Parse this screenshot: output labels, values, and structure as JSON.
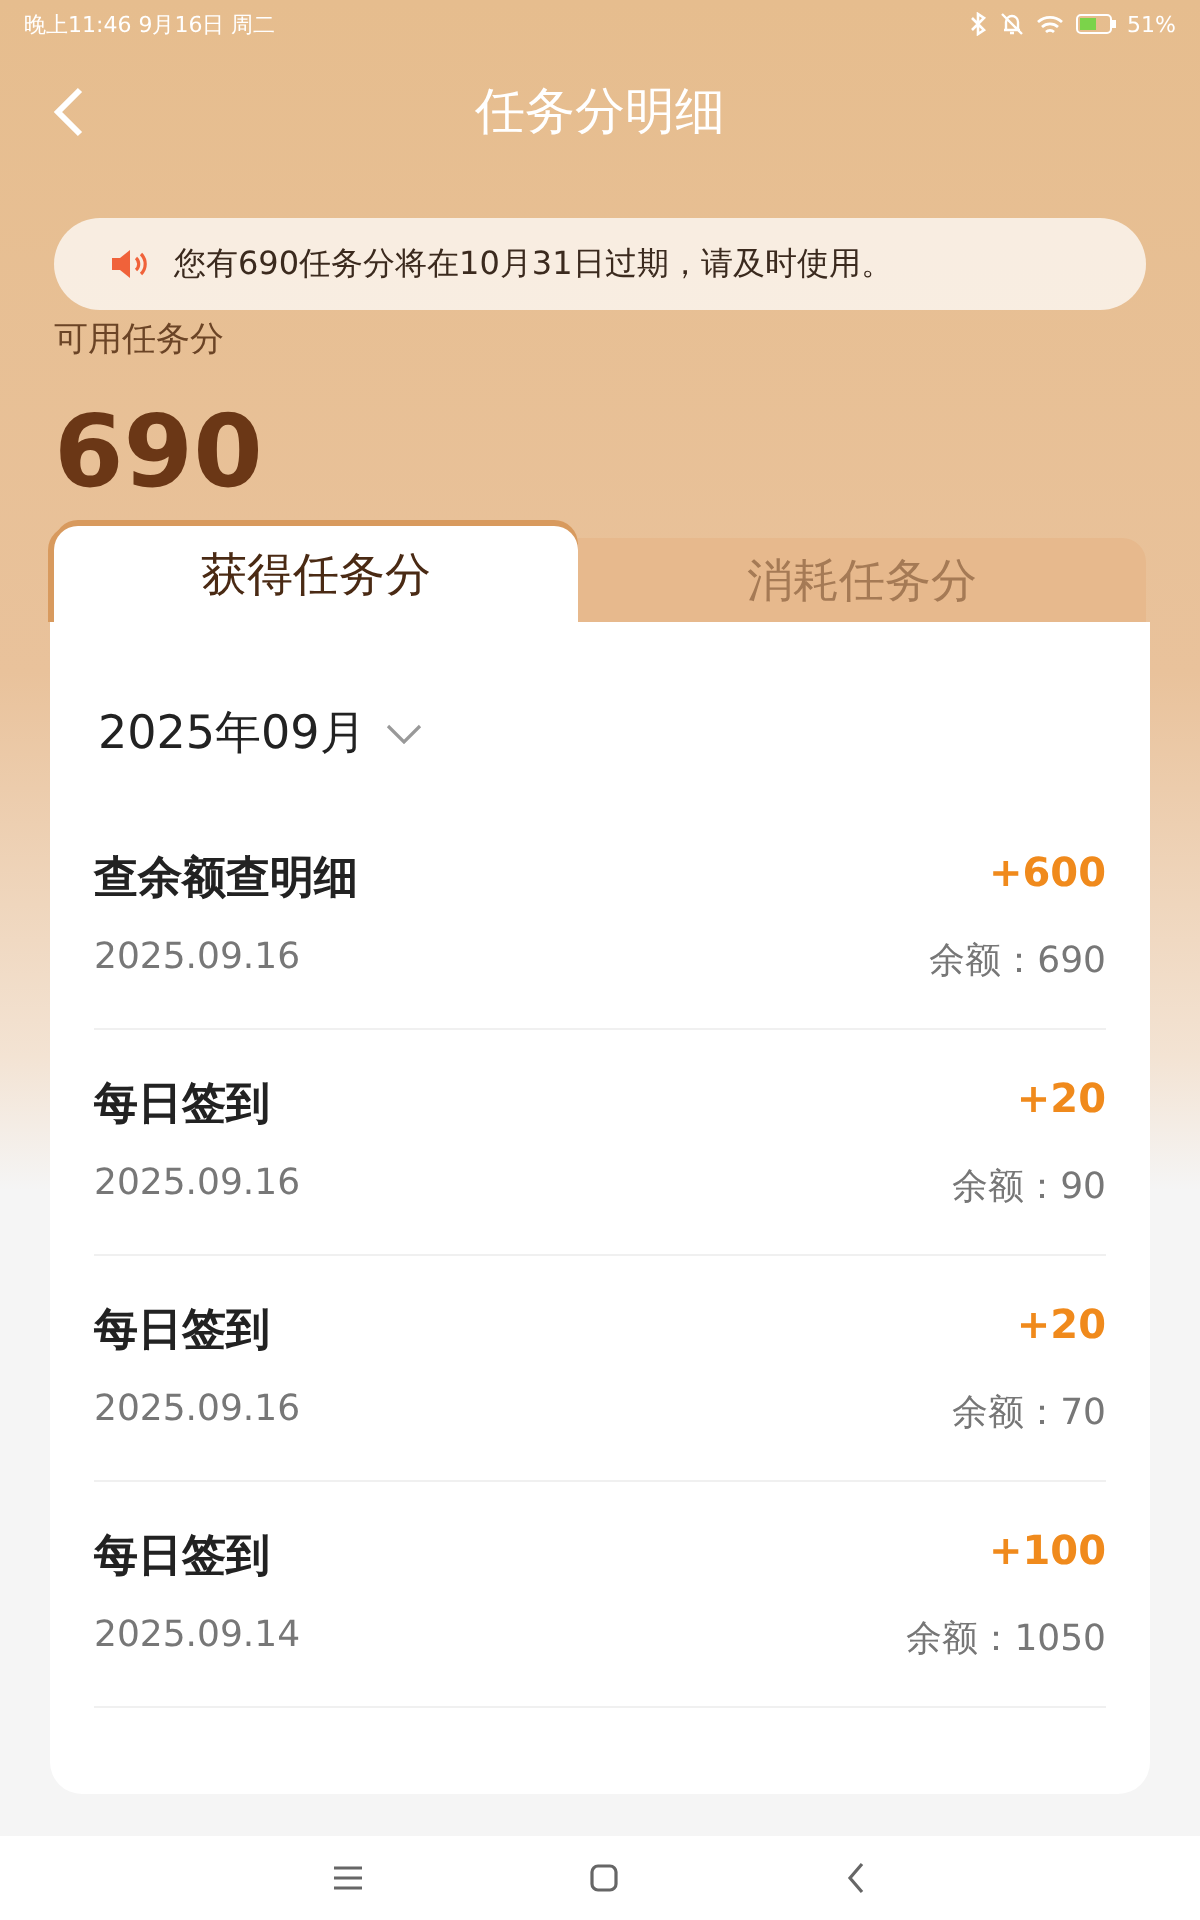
{
  "status_bar": {
    "time": "晚上11:46 9月16日 周二",
    "battery": "51%"
  },
  "header": {
    "title": "任务分明细"
  },
  "notice": {
    "text": "您有690任务分将在10月31日过期，请及时使用。"
  },
  "balance": {
    "label": "可用任务分",
    "amount": "690"
  },
  "tabs": [
    {
      "label": "获得任务分",
      "selected": true
    },
    {
      "label": "消耗任务分",
      "selected": false
    }
  ],
  "month": "2025年09月",
  "records": [
    {
      "title": "查余额查明细",
      "points": "+600",
      "date": "2025.09.16",
      "balance": "余额：690"
    },
    {
      "title": "每日签到",
      "points": "+20",
      "date": "2025.09.16",
      "balance": "余额：90"
    },
    {
      "title": "每日签到",
      "points": "+20",
      "date": "2025.09.16",
      "balance": "余额：70"
    },
    {
      "title": "每日签到",
      "points": "+100",
      "date": "2025.09.14",
      "balance": "余额：1050"
    }
  ]
}
